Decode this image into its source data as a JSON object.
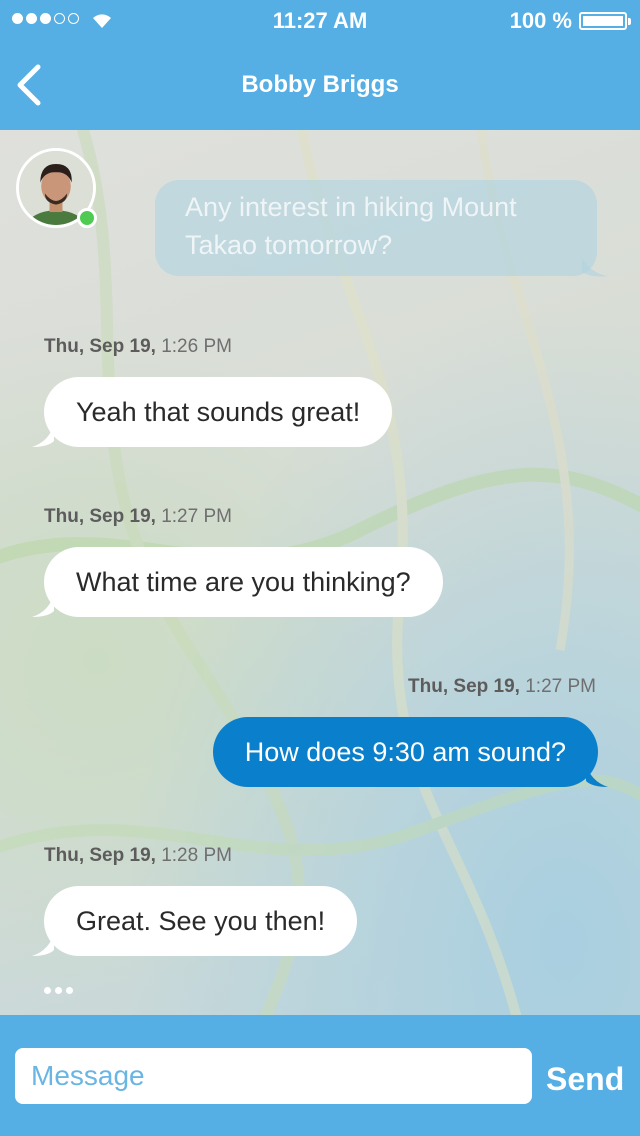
{
  "status_bar": {
    "time": "11:27 AM",
    "battery": "100 %"
  },
  "nav": {
    "title": "Bobby Briggs"
  },
  "ghost_message": "Any interest in hiking Mount Takao tomorrow?",
  "messages": [
    {
      "date": "Thu, Sep 19,",
      "time": "1:26 PM",
      "text": "Yeah that sounds great!",
      "direction": "incoming"
    },
    {
      "date": "Thu, Sep 19,",
      "time": "1:27 PM",
      "text": "What time are you thinking?",
      "direction": "incoming"
    },
    {
      "date": "Thu, Sep 19,",
      "time": "1:27 PM",
      "text": "How does 9:30 am sound?",
      "direction": "outgoing"
    },
    {
      "date": "Thu, Sep 19,",
      "time": "1:28 PM",
      "text": "Great. See you then!",
      "direction": "incoming"
    }
  ],
  "composer": {
    "placeholder": "Message",
    "send_label": "Send"
  },
  "colors": {
    "header": "#55aee4",
    "outgoing_bubble": "#0a7fcb",
    "incoming_bubble": "#ffffff",
    "online": "#4fcb54"
  },
  "icons": [
    "back-chevron-icon",
    "wifi-icon",
    "battery-icon",
    "signal-dots-icon"
  ]
}
